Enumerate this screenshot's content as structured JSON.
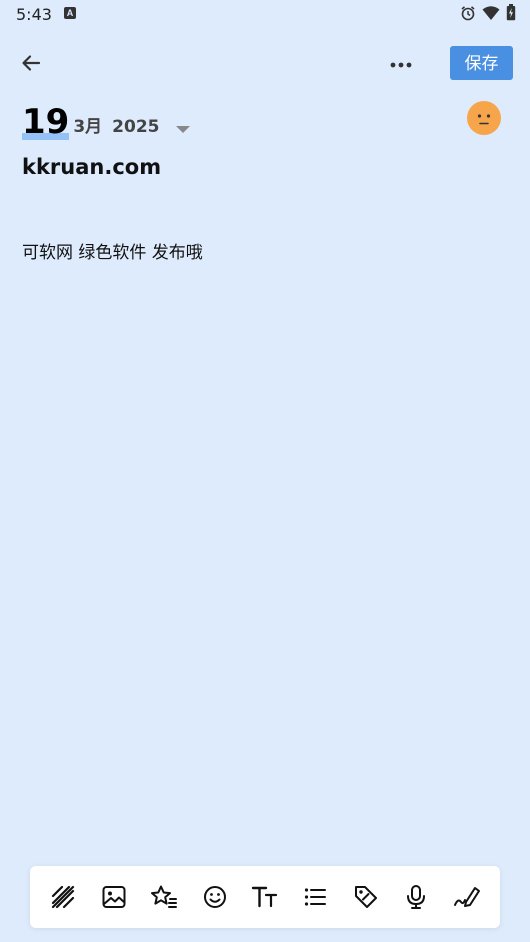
{
  "status_bar": {
    "time": "5:43",
    "app_icon_letter": "A"
  },
  "toolbar": {
    "save_label": "保存"
  },
  "date": {
    "day": "19",
    "month": "3月",
    "year": "2025"
  },
  "note": {
    "title": "kkruan.com",
    "body": "可软网 绿色软件 发布哦"
  },
  "mood": {
    "icon": "neutral-face-icon",
    "color": "#f7a54b"
  },
  "bottom_toolbar": {
    "tools": [
      "template-icon",
      "image-icon",
      "star-list-icon",
      "emoji-icon",
      "text-format-icon",
      "bullet-list-icon",
      "tag-icon",
      "microphone-icon",
      "handwriting-icon"
    ]
  },
  "colors": {
    "background": "#deebfc",
    "accent": "#4a90e2"
  }
}
